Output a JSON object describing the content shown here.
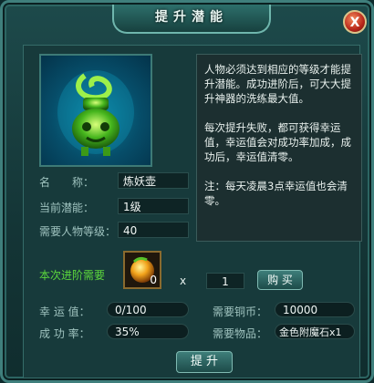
{
  "window": {
    "title": "提升潜能",
    "close_label": "X"
  },
  "description": {
    "para1": "人物必须达到相应的等级才能提升潜能。成功进阶后，可大大提升神器的洗练最大值。",
    "para2": "每次提升失败，都可获得幸运值，幸运值会对成功率加成，成功后，幸运值清零。",
    "para3": "注：每天凌晨3点幸运值也会清零。"
  },
  "info": {
    "name_label": "名　　称：",
    "name_value": "炼妖壶",
    "potential_label": "当前潜能：",
    "potential_value": "1级",
    "level_label": "需要人物等级：",
    "level_value": "40"
  },
  "advance": {
    "label": "本次进阶需要",
    "item_count": "0",
    "times_sign": "x",
    "quantity": "1",
    "buy_label": "购 买"
  },
  "stats": {
    "luck_label": "幸 运 值：",
    "luck_value": "0/100",
    "copper_label": "需要铜币：",
    "copper_value": "10000",
    "rate_label": "成 功 率：",
    "rate_value": "35%",
    "item_label": "需要物品：",
    "item_value": "金色附魔石x1"
  },
  "submit_label": "提 升",
  "icons": {
    "artifact": "green-jade-cauldron-icon",
    "item": "enchant-stone-icon",
    "close": "close-icon"
  }
}
